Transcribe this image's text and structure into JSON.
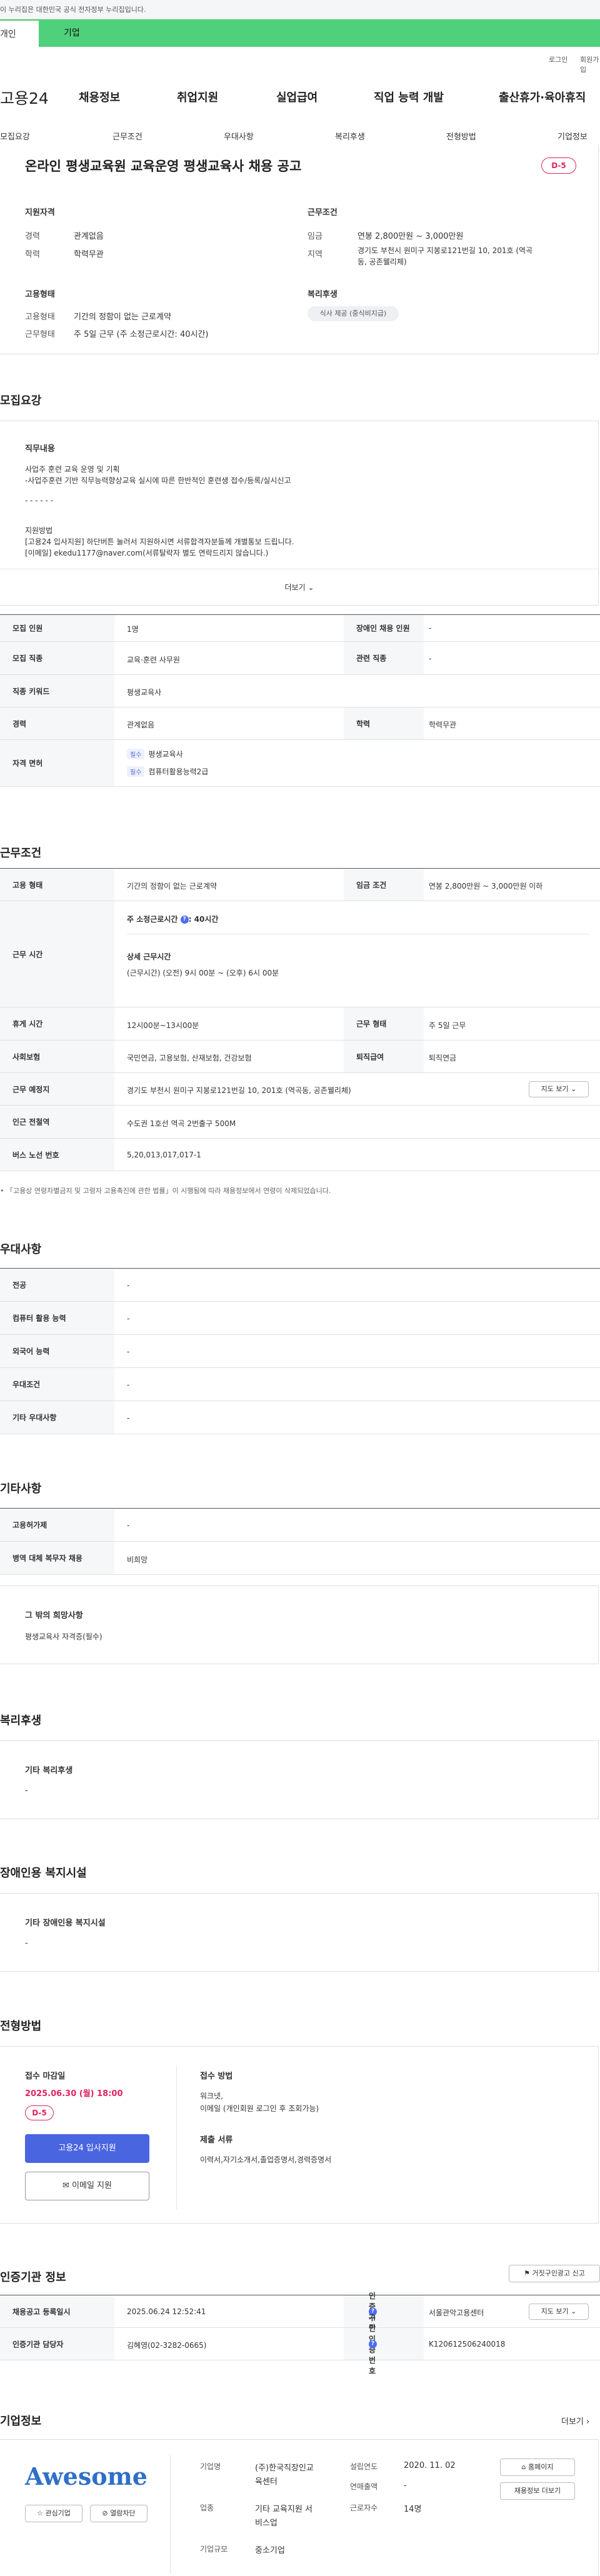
{
  "gov_banner": "이 누리집은 대한민국 공식 전자정부 누리집입니다.",
  "user_tabs": {
    "individual": "개인",
    "company": "기업"
  },
  "util": {
    "login": "로그인",
    "join": "회원가입"
  },
  "logo": "고용24",
  "gnb": [
    "채용정보",
    "취업지원",
    "실업급여",
    "직업 능력 개발",
    "출산휴가·육아휴직"
  ],
  "snb": [
    "모집요강",
    "근무조건",
    "우대사항",
    "복리후생",
    "전형방법",
    "기업정보"
  ],
  "job": {
    "title": "온라인 평생교육원 교육운영 평생교육사 채용 공고",
    "dday": "D-5",
    "qual_title": "지원자격",
    "exp_label": "경력",
    "exp_val": "관계없음",
    "edu_label": "학력",
    "edu_val": "학력무관",
    "cond_title": "근무조건",
    "wage_label": "임금",
    "wage_val": "연봉 2,800만원 ~ 3,000만원",
    "loc_label": "지역",
    "loc_val1": "경기도 부천시 원미구 지봉로121번길 10, 201호 (역곡",
    "loc_val2": "동, 공존웰리체)",
    "emp_title": "고용형태",
    "emp_label": "고용형태",
    "emp_val": "기간의 정함이 없는 근로계약",
    "hours_label": "근무형태",
    "hours_val": "주 5일 근무 (주 소정근로시간: 40시간)",
    "welfare_title": "복리후생",
    "welfare_pill": "식사 제공 (중식비지급)"
  },
  "recruit": {
    "title": "모집요강",
    "duty_title": "직무내용",
    "l1": "사업주 훈련 교육 운영 및 기획",
    "l2": "-사업주훈련 기반 직무능력향상교육 실시에 따른 한반적인 훈련생 접수/등록/실시신고",
    "l3": "- - - - - -",
    "l4": "지원방법",
    "l5": "[고용24 입사지원] 하단버튼 눌러서 지원하시면 서류합격자분들께 개별통보 드립니다.",
    "l6": "[이메일] ekedu1177@naver.com(서류탈락자 별도 연락드리지 않습니다.)",
    "more": "더보기"
  },
  "rt": {
    "r1": [
      "모집 인원",
      "1명",
      "장애인 채용 인원",
      "-"
    ],
    "r2": [
      "모집 직종",
      "교육·훈련 사무원",
      "관련 직종",
      "-"
    ],
    "r3": [
      "직종 키워드",
      "평생교육사"
    ],
    "r4": [
      "경력",
      "관계없음",
      "학력",
      "학력무관"
    ],
    "r5_label": "자격 면허",
    "req": "필수",
    "lic1": "평생교육사",
    "lic2": "컴퓨터활용능력2급"
  },
  "wc": {
    "title": "근무조건",
    "r1": [
      "고용 형태",
      "기간의 정함이 없는 근로계약",
      "임금 조건",
      "연봉 2,800만원 ~ 3,000만원 이하"
    ],
    "hours_label": "근무 시간",
    "hours_main": "주 소정근로시간",
    "hours_q": "?",
    "hours_hrs": ": 40시간",
    "detail_title": "상세 근무시간",
    "detail_val": "(근무시간) (오전) 9시 00분 ~ (오후) 6시 00분",
    "r2": [
      "휴게 시간",
      "12시00분~13시00분",
      "근무 형태",
      "주 5일 근무"
    ],
    "r3": [
      "사회보험",
      "국민연금, 고용보험, 산재보험, 건강보험",
      "퇴직급여",
      "퇴직연금"
    ],
    "r4": [
      "근무 예정지",
      "경기도 부천시 원미구 지봉로121번길 10, 201호 (역곡동, 공존웰리체)"
    ],
    "map_btn": "지도 보기",
    "r5": [
      "인근 전철역",
      "수도권 1호선 역곡 2번출구 500M"
    ],
    "r6": [
      "버스 노선 번호",
      "5,20,013,017,017-1"
    ],
    "note": "• 「고용상 연령차별금지 및 고령자 고용촉진에 관한 법률」이 시행됨에 따라 채용정보에서 연령이 삭제되었습니다."
  },
  "pref": {
    "title": "우대사항",
    "rows": [
      [
        "전공",
        "-"
      ],
      [
        "컴퓨터 활용 능력",
        "-"
      ],
      [
        "외국어 능력",
        "-"
      ],
      [
        "우대조건",
        "-"
      ],
      [
        "기타 우대사항",
        "-"
      ]
    ]
  },
  "etc": {
    "title": "기타사항",
    "rows": [
      [
        "고용허가제",
        "-"
      ],
      [
        "병역 대체 복무자 채용",
        "비희망"
      ]
    ],
    "extra_title": "그 밖의 희망사항",
    "extra_val": "평생교육사 자격증(필수)"
  },
  "benefit": {
    "title": "복리후생",
    "sub": "기타 복리후생",
    "val": "-"
  },
  "facility": {
    "title": "장애인용 복지시설",
    "sub": "기타 장애인용 복지시설",
    "val": "-"
  },
  "process": {
    "title": "전형방법",
    "deadline_label": "접수 마감일",
    "deadline": "2025.06.30 (월) 18:00",
    "dday": "D-5",
    "apply": "고용24 입사지원",
    "email": "이메일 지원",
    "method_title": "접수 방법",
    "method1": "워크넷,",
    "method2": "이메일 (개인회원 로그인 후 조회가능)",
    "doc_title": "제출 서류",
    "doc_val": "이력서,자기소개서,졸업증명서,경력증명서"
  },
  "auth": {
    "title": "인증기관 정보",
    "report": "거짓구인광고 신고",
    "r1": [
      "채용공고 등록일시",
      "2025.06.24 12:52:41",
      "인증기관",
      "서울관악고용센터"
    ],
    "map": "지도 보기",
    "r2": [
      "인증기관 담당자",
      "김혜영(02-3282-0665)",
      "구인인증번호",
      "K120612506240018"
    ]
  },
  "company": {
    "title": "기업정보",
    "more": "더보기",
    "logo": "Awesome",
    "fav": "관심기업",
    "block": "열람차단",
    "name_label": "기업명",
    "name_val1": "(주)한국직장인교",
    "name_val2": "육센터",
    "biz_label": "업종",
    "biz_val1": "기타 교육지원 서",
    "biz_val2": "비스업",
    "size_label": "기업규모",
    "size_val": "중소기업",
    "est_label": "설립연도",
    "est_val": "2020. 11. 02",
    "sales_label": "연매출액",
    "sales_val": "-",
    "emp_label": "근로자수",
    "emp_val": "14명",
    "home": "홈페이지",
    "jobs": "채용정보 더보기"
  }
}
